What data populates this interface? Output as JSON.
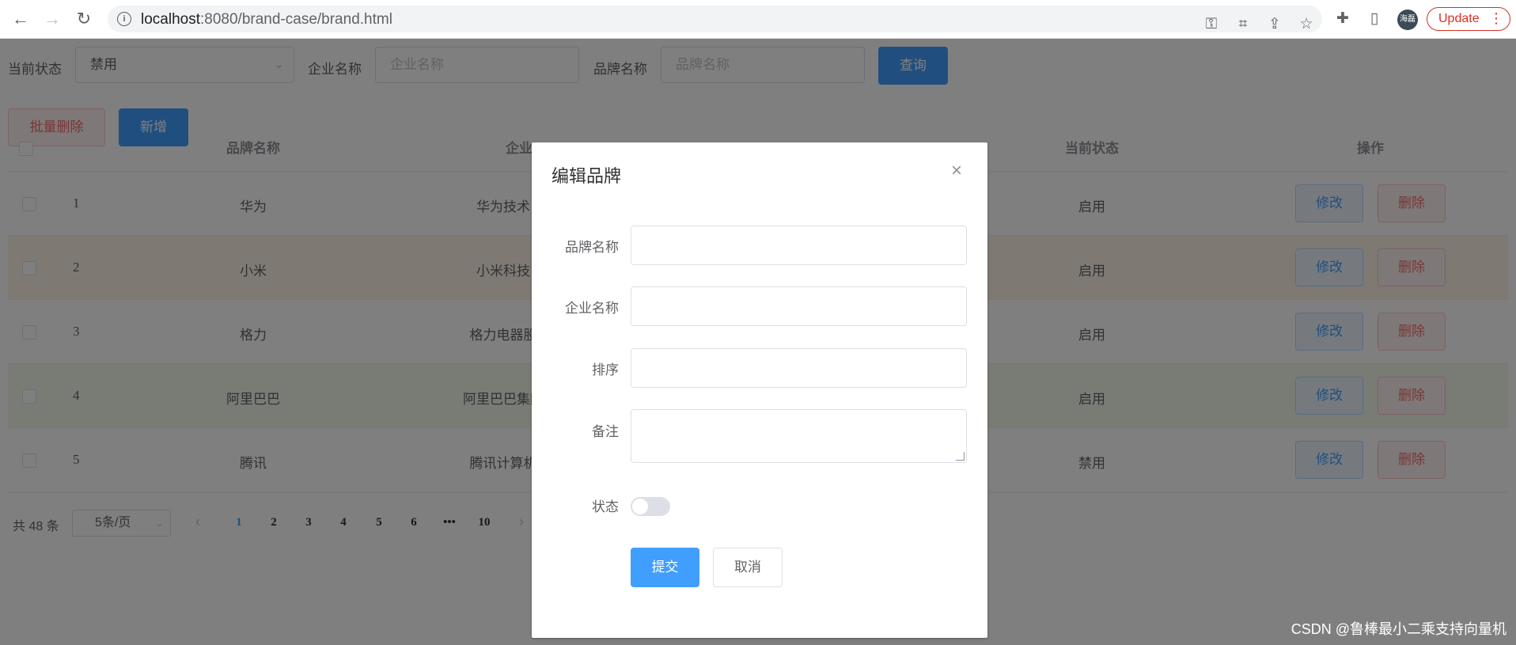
{
  "browser": {
    "url_host": "localhost",
    "url_rest": ":8080/brand-case/brand.html",
    "update_label": "Update",
    "avatar_text": "海磊"
  },
  "search": {
    "status_label": "当前状态",
    "status_value": "禁用",
    "company_label": "企业名称",
    "company_placeholder": "企业名称",
    "brand_label": "品牌名称",
    "brand_placeholder": "品牌名称",
    "query_button": "查询"
  },
  "actions": {
    "batch_delete": "批量删除",
    "add": "新增"
  },
  "table": {
    "headers": [
      "品牌名称",
      "企业",
      "当前状态",
      "操作"
    ],
    "rows": [
      {
        "index": "1",
        "brand": "华为",
        "company": "华为技术",
        "status": "启用"
      },
      {
        "index": "2",
        "brand": "小米",
        "company": "小米科技",
        "status": "启用"
      },
      {
        "index": "3",
        "brand": "格力",
        "company": "格力电器股",
        "status": "启用"
      },
      {
        "index": "4",
        "brand": "阿里巴巴",
        "company": "阿里巴巴集团",
        "status": "启用"
      },
      {
        "index": "5",
        "brand": "腾讯",
        "company": "腾讯计算机",
        "status": "禁用"
      }
    ],
    "edit_label": "修改",
    "delete_label": "删除"
  },
  "pagination": {
    "total": "共 48 条",
    "page_size": "5条/页",
    "pages": [
      "1",
      "2",
      "3",
      "4",
      "5",
      "6",
      "•••",
      "10"
    ],
    "current": "1"
  },
  "dialog": {
    "title": "编辑品牌",
    "brand_label": "品牌名称",
    "company_label": "企业名称",
    "order_label": "排序",
    "remark_label": "备注",
    "status_label": "状态",
    "submit": "提交",
    "cancel": "取消",
    "status_on": false
  },
  "watermark": "CSDN @鲁棒最小二乘支持向量机",
  "colors": {
    "primary": "#409eff",
    "danger": "#f56c6c",
    "row_warning": "#fdf5e6",
    "row_success": "#f0f9eb"
  }
}
